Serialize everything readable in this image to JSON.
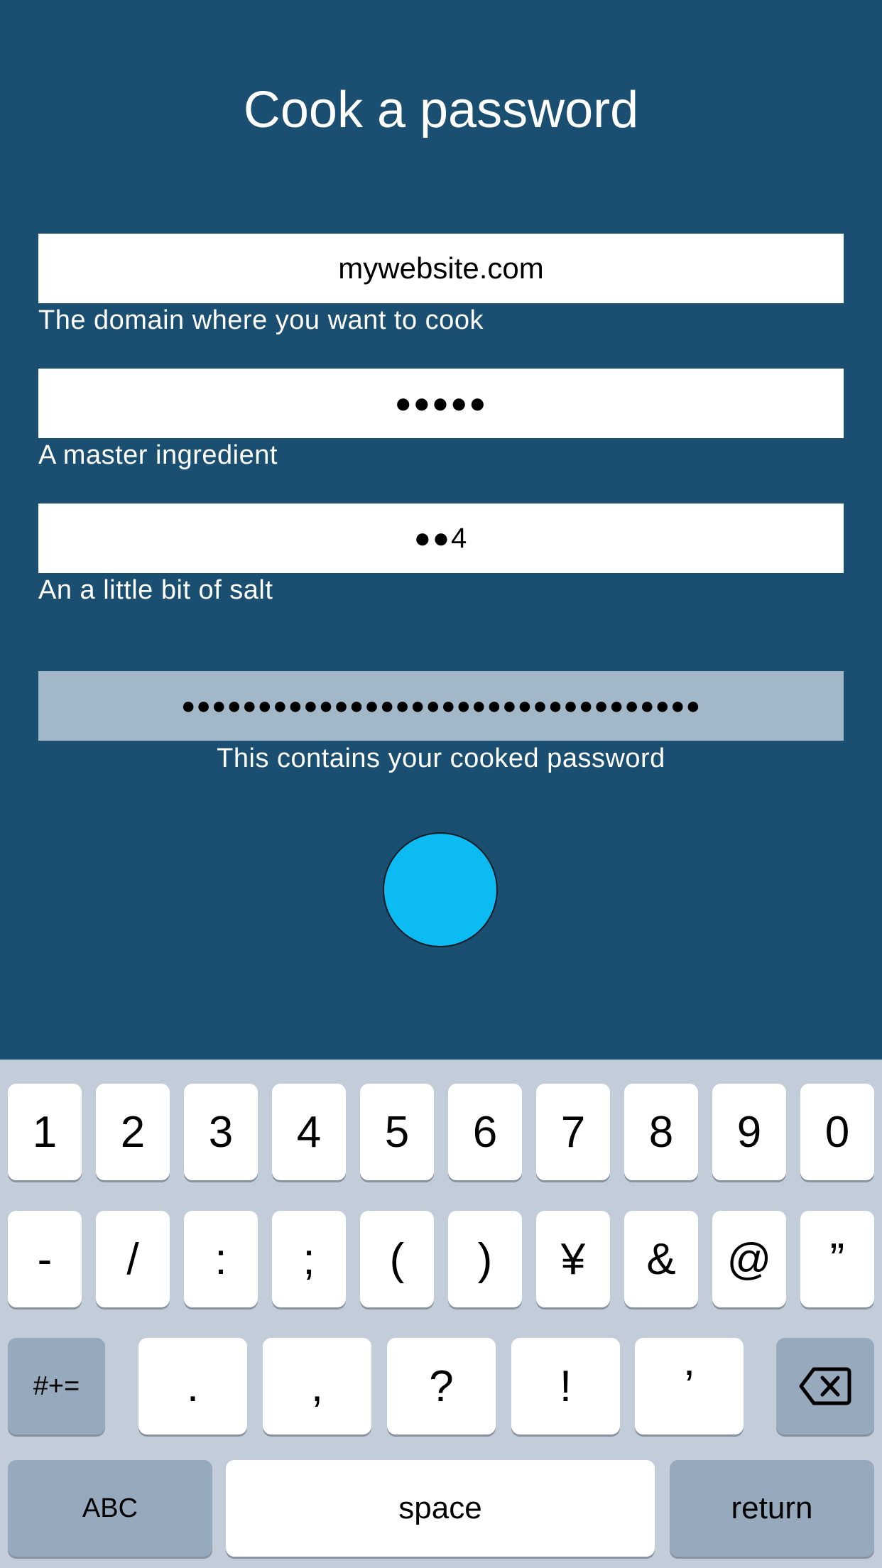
{
  "app": {
    "title": "Cook a password"
  },
  "fields": {
    "domain": {
      "value": "mywebsite.com",
      "hint": "The domain where you want to cook"
    },
    "master": {
      "value": "●●●●●",
      "hint": "A master ingredient"
    },
    "salt": {
      "value": "●●4",
      "hint": "An a little bit of salt"
    }
  },
  "result": {
    "value": "●●●●●●●●●●●●●●●●●●●●●●●●●●●●●●●●●●",
    "hint": "This contains your cooked password"
  },
  "cook_button": {
    "color": "#0bbbf2"
  },
  "keyboard": {
    "row1": [
      "1",
      "2",
      "3",
      "4",
      "5",
      "6",
      "7",
      "8",
      "9",
      "0"
    ],
    "row2": [
      "-",
      "/",
      ":",
      ";",
      "(",
      ")",
      "¥",
      "&",
      "@",
      "”"
    ],
    "row3_left": "#+=",
    "row3_keys": [
      ".",
      ",",
      "?",
      "!",
      "’"
    ],
    "row3_right_icon": "backspace-icon",
    "row4_left": "ABC",
    "row4_space": "space",
    "row4_return": "return"
  },
  "colors": {
    "background": "#1b4f72",
    "result_field": "#a2b7c7",
    "keyboard_background": "#c3cdd9",
    "dark_key": "#96a9bd"
  }
}
